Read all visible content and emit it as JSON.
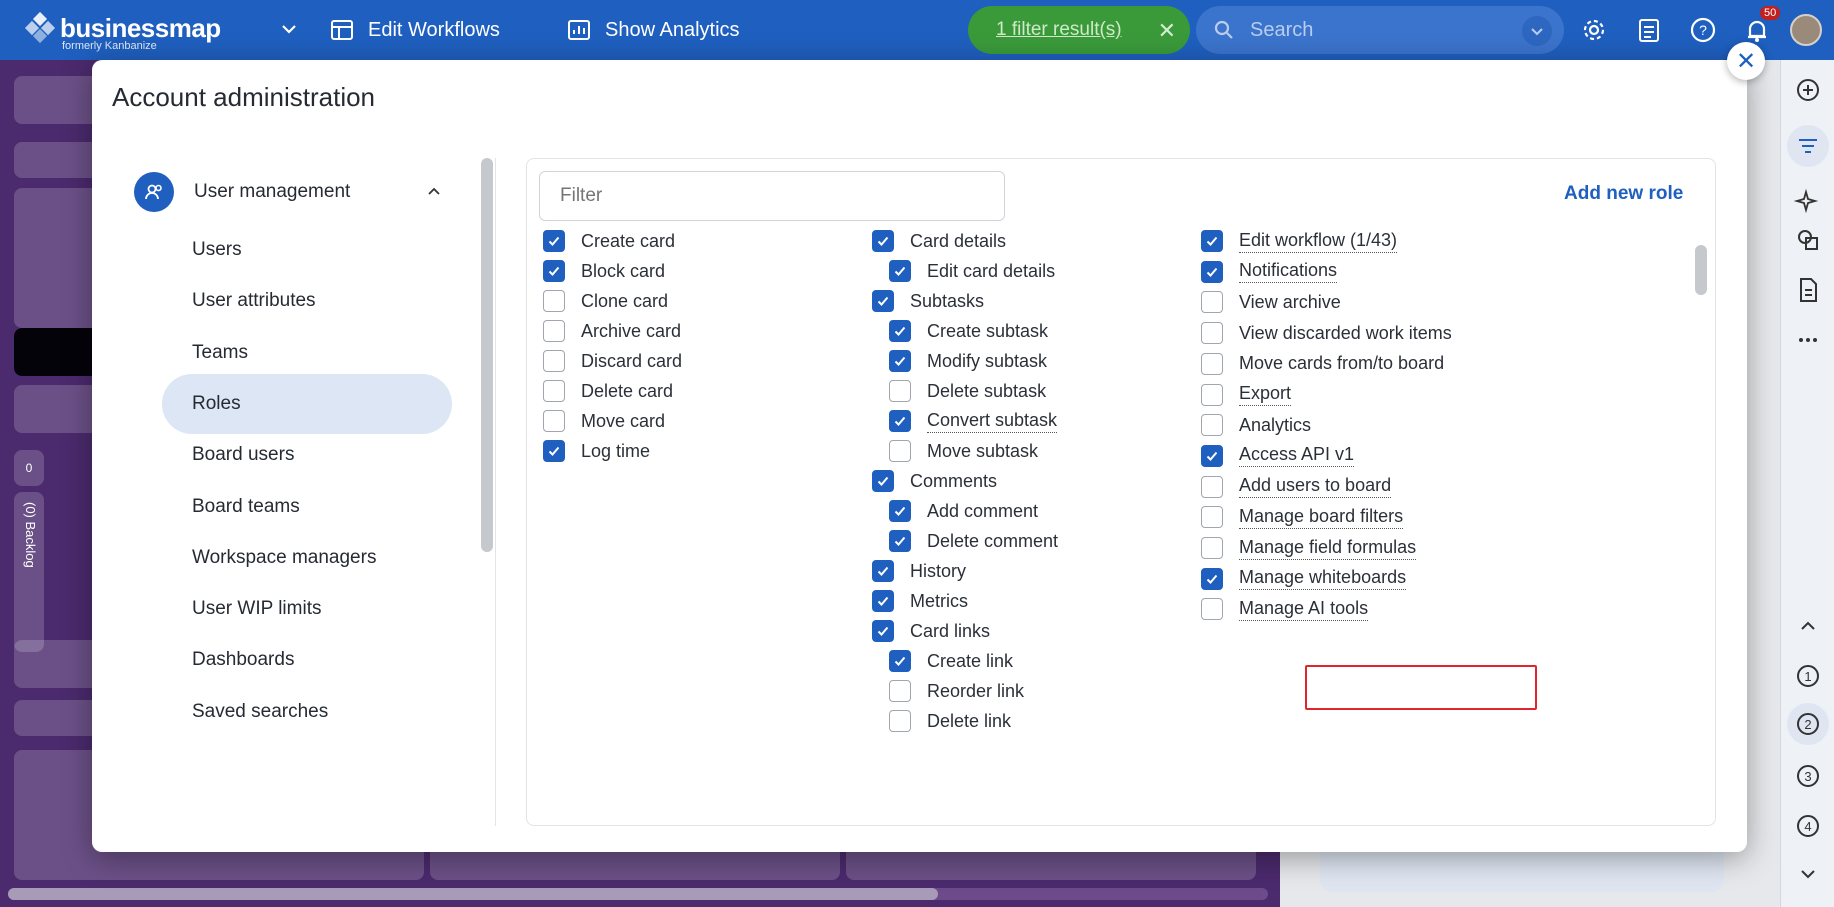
{
  "app": {
    "brand": "businessmap",
    "brand_sub": "formerly Kanbanize",
    "edit_workflows": "Edit Workflows",
    "show_analytics": "Show Analytics",
    "filter_result": "1 filter result(s)",
    "search_placeholder": "Search",
    "notification_count": "50"
  },
  "background": {
    "column_count": "0",
    "column_label": "(0) Backlog"
  },
  "modal": {
    "title": "Account administration",
    "nav": {
      "section": "User management",
      "items": [
        "Users",
        "User attributes",
        "Teams",
        "Roles",
        "Board users",
        "Board teams",
        "Workspace managers",
        "User WIP limits",
        "Dashboards",
        "Saved searches"
      ],
      "active": "Roles"
    },
    "filter_placeholder": "Filter",
    "add_new_role": "Add new role",
    "permissions": {
      "col1": [
        {
          "label": "Create card",
          "checked": true
        },
        {
          "label": "Block card",
          "checked": true
        },
        {
          "label": "Clone card",
          "checked": false
        },
        {
          "label": "Archive card",
          "checked": false
        },
        {
          "label": "Discard card",
          "checked": false
        },
        {
          "label": "Delete card",
          "checked": false
        },
        {
          "label": "Move card",
          "checked": false
        },
        {
          "label": "Log time",
          "checked": true
        }
      ],
      "col2": [
        {
          "label": "Card details",
          "checked": true
        },
        {
          "label": "Edit card details",
          "checked": true
        },
        {
          "label": "Subtasks",
          "checked": true
        },
        {
          "label": "Create subtask",
          "checked": true
        },
        {
          "label": "Modify subtask",
          "checked": true
        },
        {
          "label": "Delete subtask",
          "checked": false
        },
        {
          "label": "Convert subtask",
          "checked": true
        },
        {
          "label": "Move subtask",
          "checked": false
        },
        {
          "label": "Comments",
          "checked": true
        },
        {
          "label": "Add comment",
          "checked": true
        },
        {
          "label": "Delete comment",
          "checked": true
        },
        {
          "label": "History",
          "checked": true
        },
        {
          "label": "Metrics",
          "checked": true
        },
        {
          "label": "Card links",
          "checked": true
        },
        {
          "label": "Create link",
          "checked": true
        },
        {
          "label": "Reorder link",
          "checked": false
        },
        {
          "label": "Delete link",
          "checked": false
        }
      ],
      "col3": [
        {
          "label": "Edit workflow (1/43)",
          "checked": true
        },
        {
          "label": "Notifications",
          "checked": true
        },
        {
          "label": "View archive",
          "checked": false
        },
        {
          "label": "View discarded work items",
          "checked": false
        },
        {
          "label": "Move cards from/to board",
          "checked": false
        },
        {
          "label": "Export",
          "checked": false
        },
        {
          "label": "Analytics",
          "checked": false
        },
        {
          "label": "Access API v1",
          "checked": true
        },
        {
          "label": "Add users to board",
          "checked": false
        },
        {
          "label": "Manage board filters",
          "checked": false
        },
        {
          "label": "Manage field formulas",
          "checked": false
        },
        {
          "label": "Manage whiteboards",
          "checked": true
        },
        {
          "label": "Manage AI tools",
          "checked": false
        }
      ]
    }
  },
  "colors": {
    "primary": "#1f5fbf",
    "filter_green": "#3a9a3a",
    "active_nav": "#dce6f4",
    "highlight": "#e0262d"
  }
}
